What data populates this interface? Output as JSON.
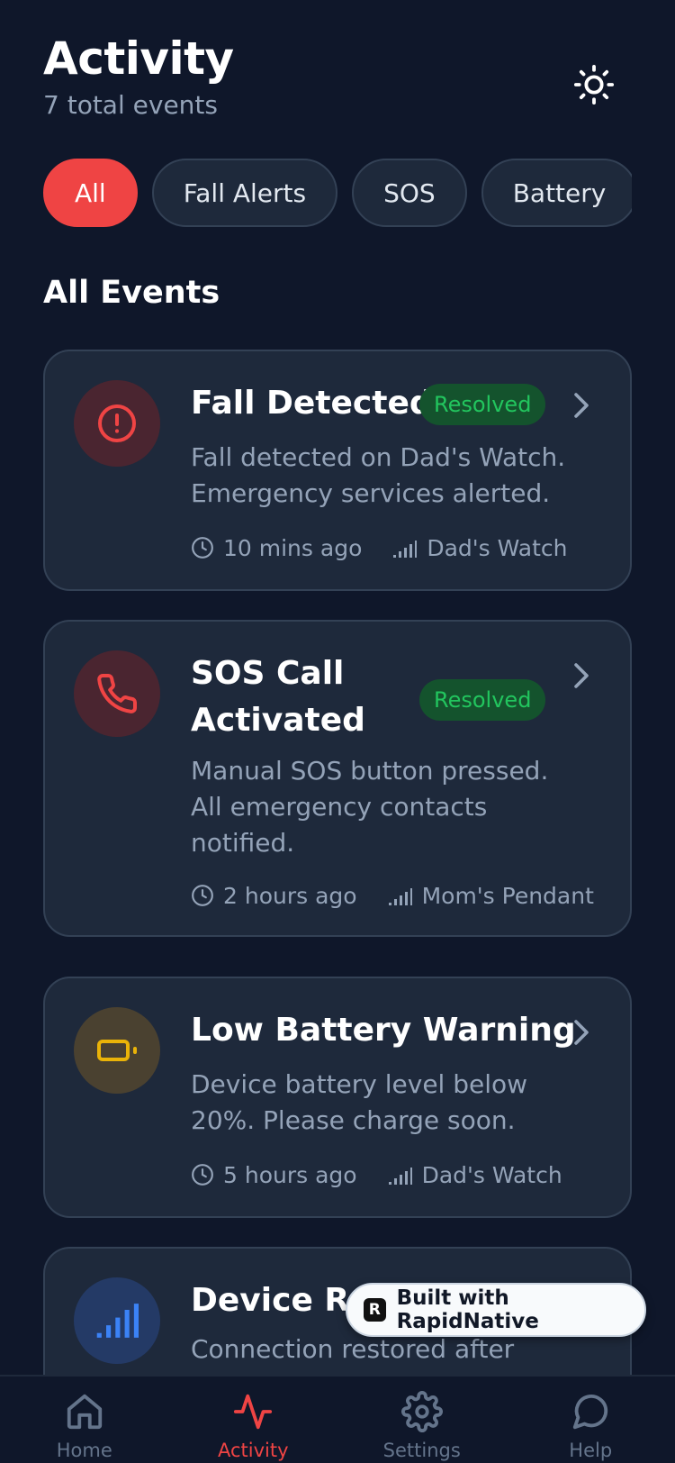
{
  "header": {
    "title": "Activity",
    "subtitle": "7 total events",
    "theme_icon": "sun-icon"
  },
  "filters": [
    {
      "label": "All",
      "active": true
    },
    {
      "label": "Fall Alerts",
      "active": false
    },
    {
      "label": "SOS",
      "active": false
    },
    {
      "label": "Battery",
      "active": false
    },
    {
      "label": "",
      "active": false
    }
  ],
  "section_title": "All Events",
  "events": [
    {
      "title": "Fall Detected",
      "status": "Resolved",
      "description_lines": [
        "Fall detected on Dad's Watch.",
        "Emergency services alerted."
      ],
      "time": "10 mins ago",
      "device": "Dad's Watch",
      "icon": "alert-circle-icon",
      "color": "#ef4444"
    },
    {
      "title_lines": [
        "SOS Call",
        "Activated"
      ],
      "status": "Resolved",
      "description_lines": [
        "Manual SOS button pressed.",
        "All emergency contacts",
        "notified."
      ],
      "time": "2 hours ago",
      "device": "Mom's Pendant",
      "icon": "phone-icon",
      "color": "#ef4444"
    },
    {
      "title": "Low Battery Warning",
      "description_lines": [
        "Device battery level below",
        "20%. Please charge soon."
      ],
      "time": "5 hours ago",
      "device": "Dad's Watch",
      "icon": "battery-low-icon",
      "color": "#eab308"
    },
    {
      "title": "Device Re",
      "description_lines": [
        "Connection restored after"
      ],
      "icon": "signal-icon",
      "color": "#3b82f6"
    }
  ],
  "tabs": [
    {
      "label": "Home",
      "icon": "home-icon",
      "active": false
    },
    {
      "label": "Activity",
      "icon": "activity-icon",
      "active": true
    },
    {
      "label": "Settings",
      "icon": "gear-icon",
      "active": false
    },
    {
      "label": "Help",
      "icon": "chat-bubble-icon",
      "active": false
    }
  ],
  "brand_badge": {
    "text": "Built with RapidNative",
    "logo_letter": "R"
  },
  "colors": {
    "background": "#0f172a",
    "card": "#1e293b",
    "accent": "#ef4444",
    "success": "#22c55e",
    "muted": "#94a3b8"
  }
}
